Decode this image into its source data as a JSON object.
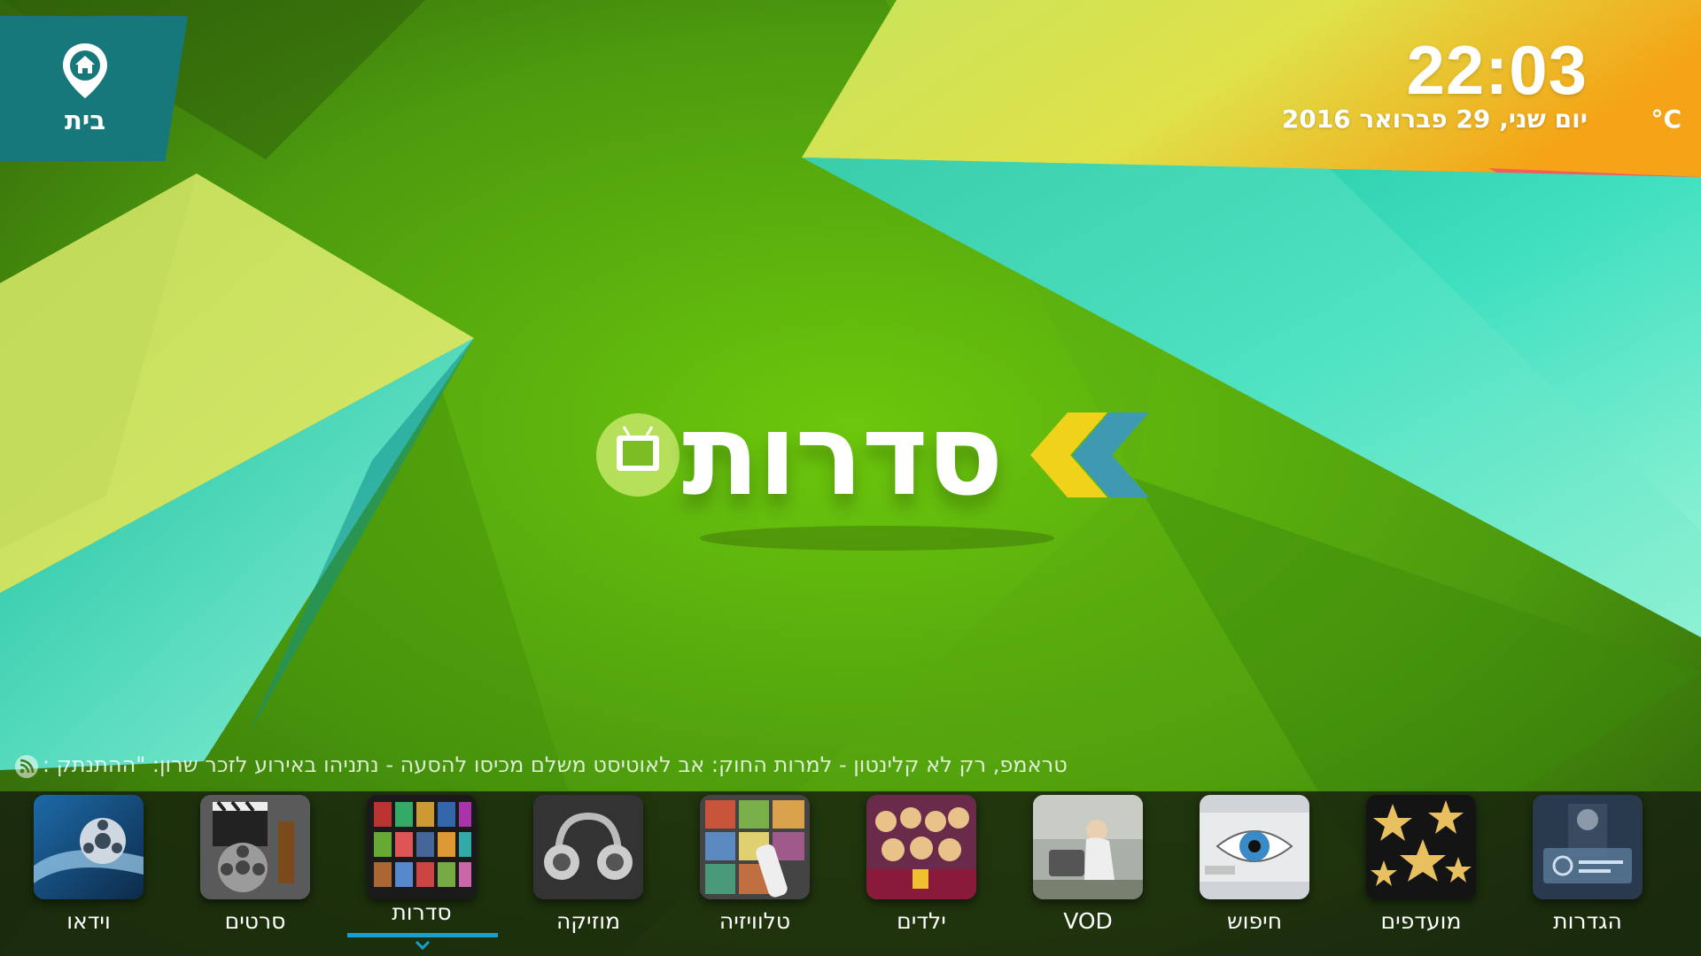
{
  "home": {
    "label": "בית",
    "icon": "home-pin-icon"
  },
  "status": {
    "time": "22:03",
    "date": "יום שני, 29 פברואר 2016",
    "temperature": "°C"
  },
  "section_logo": {
    "title": "סדרות",
    "icon": "tv-icon"
  },
  "ticker": {
    "icon": "rss-icon",
    "text": "טראמפ, רק לא קלינטון - למרות החוק: אב לאוטיסט משלם מכיסו להסעה - נתניהו באירוע לזכר שרון: \"ההתנתק :"
  },
  "menu": {
    "items": [
      {
        "label": "וידאו",
        "icon": "video-film-icon"
      },
      {
        "label": "סרטים",
        "icon": "clapperboard-reel-icon"
      },
      {
        "label": "סדרות",
        "icon": "series-posters-icon",
        "active": true
      },
      {
        "label": "מוזיקה",
        "icon": "headphones-icon"
      },
      {
        "label": "טלוויזיה",
        "icon": "tv-remote-icon"
      },
      {
        "label": "ילדים",
        "icon": "kids-cinema-icon"
      },
      {
        "label": "VOD",
        "icon": "vod-icon"
      },
      {
        "label": "חיפוש",
        "icon": "eye-search-icon"
      },
      {
        "label": "מועדפים",
        "icon": "stars-favorites-icon"
      },
      {
        "label": "הגדרות",
        "icon": "settings-icon"
      }
    ]
  },
  "colors": {
    "background_green": "#4f9a10",
    "accent_yellow_green": "#c8e063",
    "accent_teal": "#2dd4b0",
    "accent_orange": "#f4a818",
    "home_tile": "#16787a",
    "active_underline": "#17a0d4"
  }
}
